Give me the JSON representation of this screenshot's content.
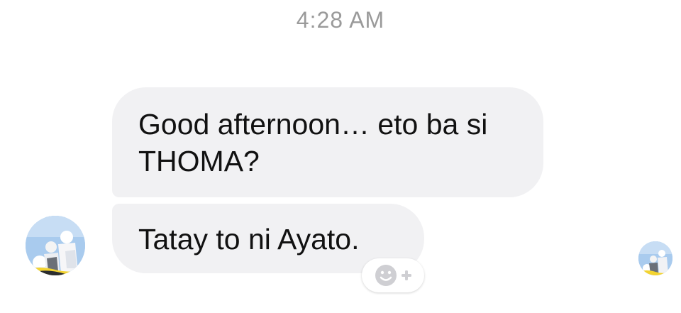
{
  "thread": {
    "timestamp": "4:28 AM",
    "messages": [
      {
        "text": "Good afternoon… eto ba si THOMA?"
      },
      {
        "text": "Tatay to ni Ayato."
      }
    ]
  },
  "icons": {
    "sender_avatar": "profile-avatar",
    "read_receipt": "read-receipt-avatar",
    "add_reaction": "smiley-plus-icon"
  },
  "colors": {
    "bubble": "#f1f1f3",
    "timestamp": "#9a9a9a",
    "text": "#111111"
  }
}
